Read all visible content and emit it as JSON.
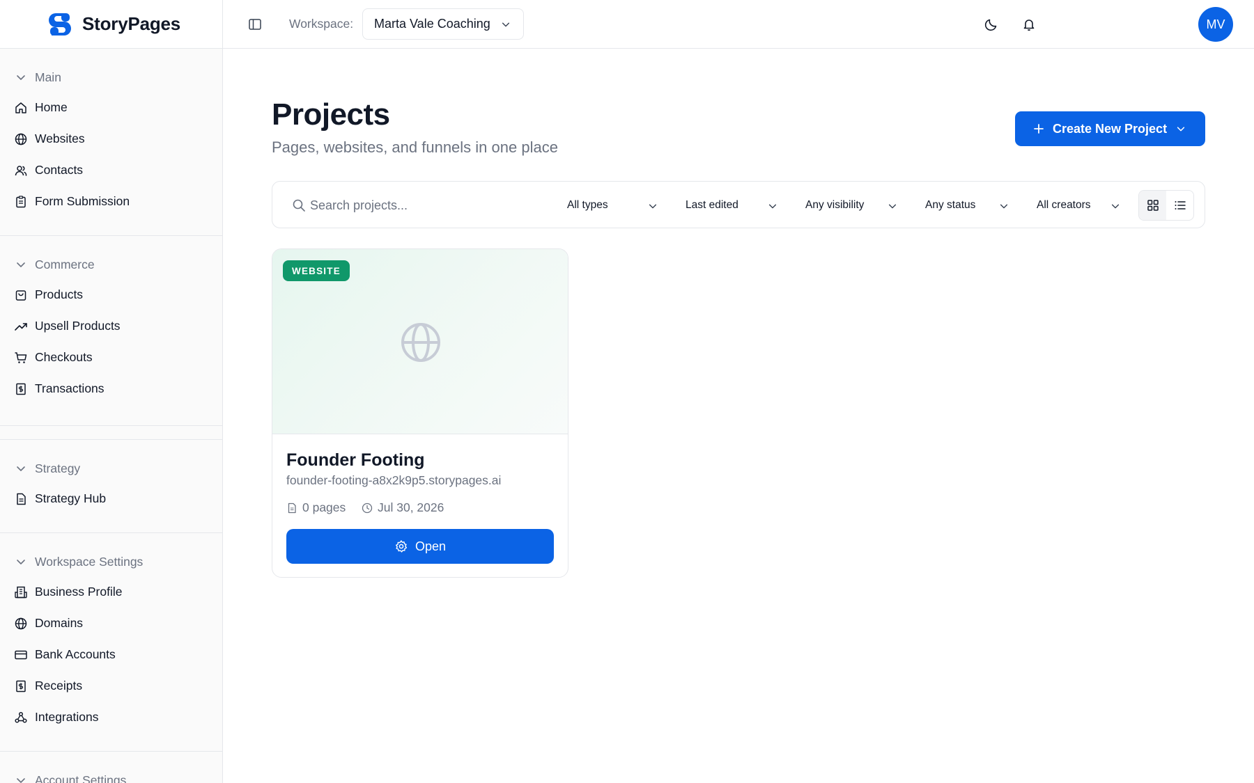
{
  "brand": {
    "name": "StoryPages",
    "logo_icon": "storypages-logo-icon",
    "logo_color": "#0b63e5"
  },
  "sidebar": {
    "sections": [
      {
        "title": "Main",
        "items": [
          {
            "label": "Home",
            "icon": "home-icon"
          },
          {
            "label": "Websites",
            "icon": "globe-icon"
          },
          {
            "label": "Contacts",
            "icon": "users-icon"
          },
          {
            "label": "Form Submission",
            "icon": "clipboard-icon"
          }
        ]
      },
      {
        "title": "Commerce",
        "items": [
          {
            "label": "Products",
            "icon": "shopping-bag-icon"
          },
          {
            "label": "Upsell Products",
            "icon": "trending-up-icon"
          },
          {
            "label": "Checkouts",
            "icon": "cart-icon"
          },
          {
            "label": "Transactions",
            "icon": "dollar-receipt-icon"
          }
        ]
      },
      {
        "title": "Strategy",
        "items": [
          {
            "label": "Strategy Hub",
            "icon": "document-icon"
          }
        ]
      },
      {
        "title": "Workspace Settings",
        "items": [
          {
            "label": "Business Profile",
            "icon": "building-icon"
          },
          {
            "label": "Domains",
            "icon": "globe-icon"
          },
          {
            "label": "Bank Accounts",
            "icon": "credit-card-icon"
          },
          {
            "label": "Receipts",
            "icon": "dollar-receipt-icon"
          },
          {
            "label": "Integrations",
            "icon": "webhook-icon"
          }
        ]
      },
      {
        "title": "Account Settings",
        "items": []
      }
    ]
  },
  "topbar": {
    "workspace_label": "Workspace:",
    "workspace_value": "Marta Vale Coaching",
    "avatar_initials": "MV"
  },
  "main": {
    "title": "Projects",
    "subtitle": "Pages, websites, and funnels in one place",
    "create_button": "Create New Project",
    "search_placeholder": "Search projects...",
    "filters": {
      "type": "All types",
      "sort": "Last edited",
      "visibility": "Any visibility",
      "status": "Any status",
      "creator": "All creators"
    },
    "view_mode": "grid"
  },
  "projects": [
    {
      "badge": "WEBSITE",
      "name": "Founder Footing",
      "url": "founder-footing-a8x2k9p5.storypages.ai",
      "pages": "0 pages",
      "date": "Jul 30, 2026",
      "open_label": "Open"
    }
  ],
  "colors": {
    "primary": "#0b63e5",
    "badge_green": "#10986a"
  }
}
